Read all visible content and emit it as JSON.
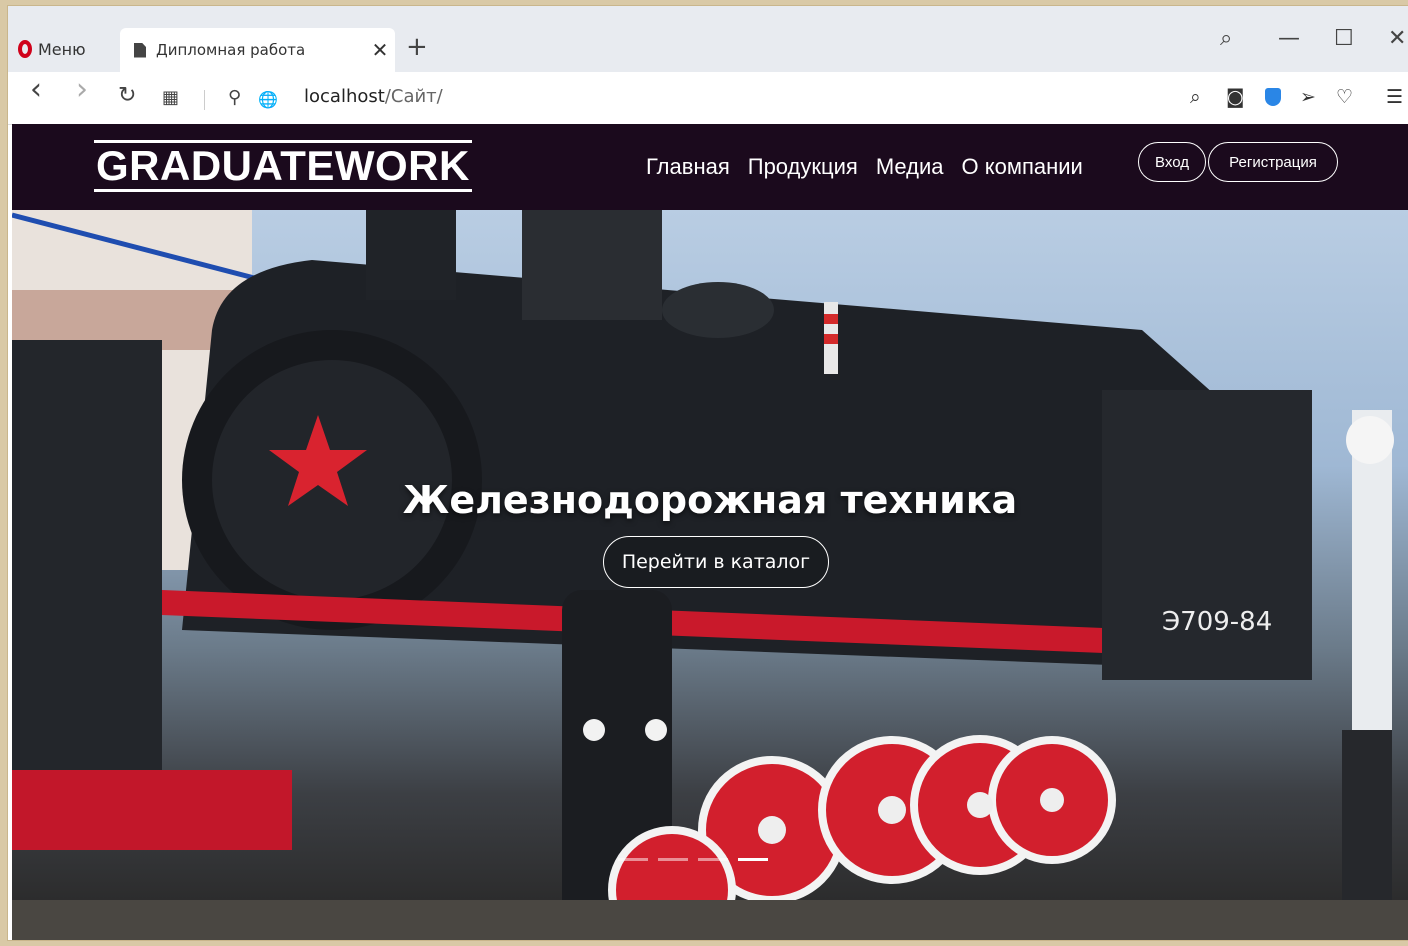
{
  "browser": {
    "menu_label": "Меню",
    "tab_title": "Дипломная работа",
    "tab_close": "✕",
    "new_tab": "+",
    "url_host": "localhost",
    "url_path": "/Сайт/",
    "back": "‹",
    "forward": "›",
    "reload": "↻",
    "speed_dial": "▦",
    "search": "⌕",
    "minimize": "—",
    "maximize": "☐",
    "close": "✕",
    "key_icon": "⚲",
    "globe_icon": "🌐",
    "zoom_icon": "⌕",
    "camera_icon": "◙",
    "send_icon": "➢",
    "heart_icon": "♡",
    "easy_setup_icon": "☰"
  },
  "site": {
    "logo": "GRADUATEWORK",
    "nav": [
      "Главная",
      "Продукция",
      "Медиа",
      "О компании"
    ],
    "login": "Вход",
    "register": "Регистрация"
  },
  "hero": {
    "title": "Железнодорожная техника",
    "cta": "Перейти в каталог",
    "slides_total": 4,
    "active_slide": 4
  }
}
